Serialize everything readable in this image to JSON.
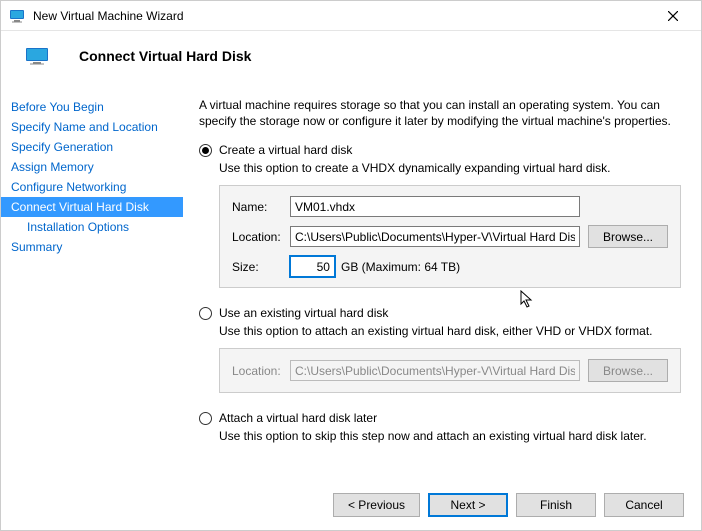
{
  "window": {
    "title": "New Virtual Machine Wizard"
  },
  "header": {
    "title": "Connect Virtual Hard Disk"
  },
  "nav": {
    "items": [
      "Before You Begin",
      "Specify Name and Location",
      "Specify Generation",
      "Assign Memory",
      "Configure Networking",
      "Connect Virtual Hard Disk",
      "Installation Options",
      "Summary"
    ],
    "selected_index": 5,
    "child_indices": [
      6
    ]
  },
  "intro": "A virtual machine requires storage so that you can install an operating system. You can specify the storage now or configure it later by modifying the virtual machine's properties.",
  "option_create": {
    "label": "Create a virtual hard disk",
    "desc": "Use this option to create a VHDX dynamically expanding virtual hard disk.",
    "name_label": "Name:",
    "name_value": "VM01.vhdx",
    "location_label": "Location:",
    "location_value": "C:\\Users\\Public\\Documents\\Hyper-V\\Virtual Hard Disks\\",
    "browse_label": "Browse...",
    "size_label": "Size:",
    "size_value": "50",
    "size_unit": "GB (Maximum: 64 TB)"
  },
  "option_existing": {
    "label": "Use an existing virtual hard disk",
    "desc": "Use this option to attach an existing virtual hard disk, either VHD or VHDX format.",
    "location_label": "Location:",
    "location_value": "C:\\Users\\Public\\Documents\\Hyper-V\\Virtual Hard Disks\\",
    "browse_label": "Browse..."
  },
  "option_later": {
    "label": "Attach a virtual hard disk later",
    "desc": "Use this option to skip this step now and attach an existing virtual hard disk later."
  },
  "selected_option": "create",
  "footer": {
    "previous": "< Previous",
    "next": "Next >",
    "finish": "Finish",
    "cancel": "Cancel"
  }
}
